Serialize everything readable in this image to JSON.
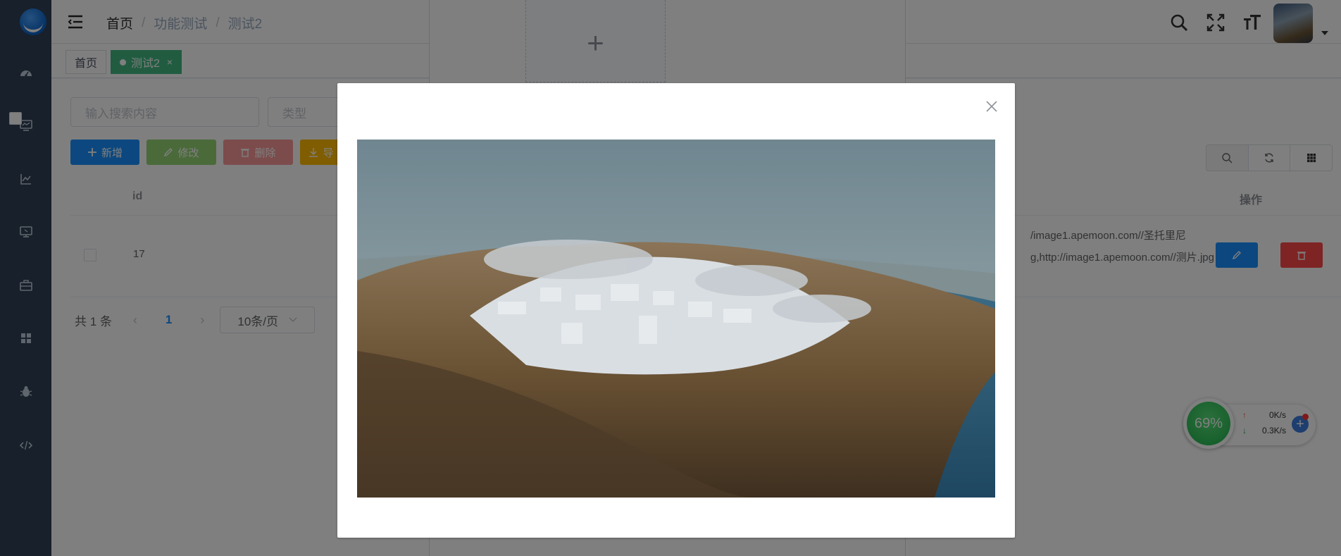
{
  "breadcrumb": {
    "home": "首页",
    "sep1": "/",
    "level2": "功能测试",
    "sep2": "/",
    "current": "测试2"
  },
  "tags": {
    "home": "首页",
    "active": "测试2",
    "active_close": "×"
  },
  "search": {
    "placeholder": "输入搜索内容",
    "type_placeholder": "类型"
  },
  "toolbar": {
    "add": "新增",
    "edit": "修改",
    "delete": "删除",
    "export": "导"
  },
  "table": {
    "columns": {
      "id": "id",
      "operation": "操作"
    },
    "rows": [
      {
        "id": "17",
        "url": "/image1.apemoon.com//圣托里尼g,http://image1.apemoon.com//测片.jpg"
      }
    ]
  },
  "pagination": {
    "total": "共 1 条",
    "prev": "‹",
    "page": "1",
    "next": "›",
    "page_size": "10条/页"
  },
  "upload": {
    "plus": "+"
  },
  "network": {
    "percent": "69%",
    "up": "0K/s",
    "down": "0.3K/s",
    "up_arrow": "↑",
    "down_arrow": "↓",
    "plus": "+"
  },
  "colors": {
    "sidebar": "#304156",
    "primary": "#1890ff",
    "success": "#42b983",
    "danger": "#ff4949",
    "warning": "#ffba00"
  },
  "icons": [
    "logo-icon",
    "dashboard-icon",
    "monitor-icon",
    "chart-icon",
    "screen-icon",
    "toolbox-icon",
    "apps-icon",
    "bug-icon",
    "code-icon",
    "hamburger-icon",
    "search-icon",
    "fullscreen-icon",
    "font-size-icon",
    "close-icon",
    "refresh-icon",
    "grid-icon",
    "edit-icon",
    "delete-icon",
    "plus-icon",
    "download-icon"
  ]
}
